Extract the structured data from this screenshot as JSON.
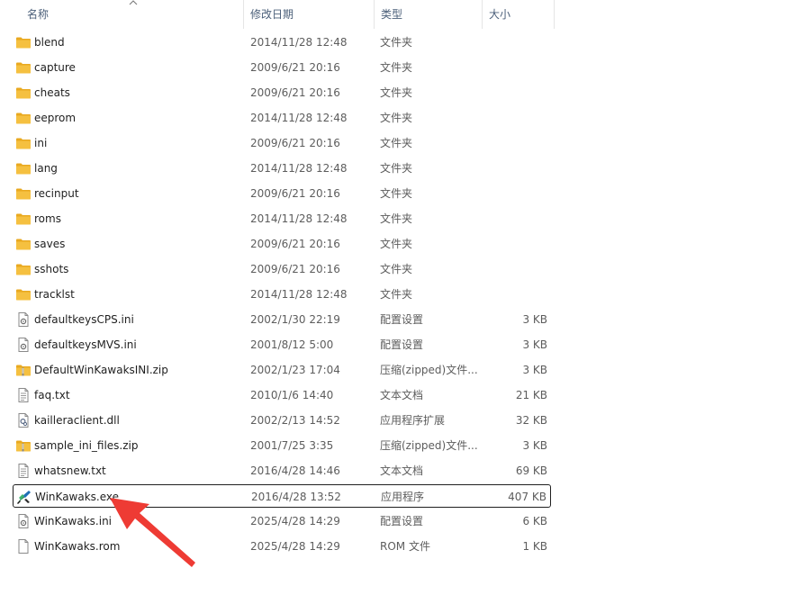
{
  "columns": {
    "name": "名称",
    "date": "修改日期",
    "type": "类型",
    "size": "大小"
  },
  "colors": {
    "folder": "#f5c040",
    "arrow": "#ee3b34",
    "header_text": "#4c607a"
  },
  "files": [
    {
      "name": "blend",
      "date": "2014/11/28 12:48",
      "type": "文件夹",
      "size": "",
      "icon": "folder-icon"
    },
    {
      "name": "capture",
      "date": "2009/6/21 20:16",
      "type": "文件夹",
      "size": "",
      "icon": "folder-icon"
    },
    {
      "name": "cheats",
      "date": "2009/6/21 20:16",
      "type": "文件夹",
      "size": "",
      "icon": "folder-icon"
    },
    {
      "name": "eeprom",
      "date": "2014/11/28 12:48",
      "type": "文件夹",
      "size": "",
      "icon": "folder-icon"
    },
    {
      "name": "ini",
      "date": "2009/6/21 20:16",
      "type": "文件夹",
      "size": "",
      "icon": "folder-icon"
    },
    {
      "name": "lang",
      "date": "2014/11/28 12:48",
      "type": "文件夹",
      "size": "",
      "icon": "folder-icon"
    },
    {
      "name": "recinput",
      "date": "2009/6/21 20:16",
      "type": "文件夹",
      "size": "",
      "icon": "folder-icon"
    },
    {
      "name": "roms",
      "date": "2014/11/28 12:48",
      "type": "文件夹",
      "size": "",
      "icon": "folder-icon"
    },
    {
      "name": "saves",
      "date": "2009/6/21 20:16",
      "type": "文件夹",
      "size": "",
      "icon": "folder-icon"
    },
    {
      "name": "sshots",
      "date": "2009/6/21 20:16",
      "type": "文件夹",
      "size": "",
      "icon": "folder-icon"
    },
    {
      "name": "tracklst",
      "date": "2014/11/28 12:48",
      "type": "文件夹",
      "size": "",
      "icon": "folder-icon"
    },
    {
      "name": "defaultkeysCPS.ini",
      "date": "2002/1/30 22:19",
      "type": "配置设置",
      "size": "3 KB",
      "icon": "config-file-icon"
    },
    {
      "name": "defaultkeysMVS.ini",
      "date": "2001/8/12 5:00",
      "type": "配置设置",
      "size": "3 KB",
      "icon": "config-file-icon"
    },
    {
      "name": "DefaultWinKawaksINI.zip",
      "date": "2002/1/23 17:04",
      "type": "压缩(zipped)文件...",
      "size": "3 KB",
      "icon": "zip-folder-icon"
    },
    {
      "name": "faq.txt",
      "date": "2010/1/6 14:40",
      "type": "文本文档",
      "size": "21 KB",
      "icon": "text-file-icon"
    },
    {
      "name": "kailleraclient.dll",
      "date": "2002/2/13 14:52",
      "type": "应用程序扩展",
      "size": "32 KB",
      "icon": "dll-file-icon"
    },
    {
      "name": "sample_ini_files.zip",
      "date": "2001/7/25 3:35",
      "type": "压缩(zipped)文件...",
      "size": "3 KB",
      "icon": "zip-folder-icon"
    },
    {
      "name": "whatsnew.txt",
      "date": "2016/4/28 14:46",
      "type": "文本文档",
      "size": "69 KB",
      "icon": "text-file-icon"
    },
    {
      "name": "WinKawaks.exe",
      "date": "2016/4/28 13:52",
      "type": "应用程序",
      "size": "407 KB",
      "icon": "app-exe-icon",
      "selected": true
    },
    {
      "name": "WinKawaks.ini",
      "date": "2025/4/28 14:29",
      "type": "配置设置",
      "size": "6 KB",
      "icon": "config-file-icon"
    },
    {
      "name": "WinKawaks.rom",
      "date": "2025/4/28 14:29",
      "type": "ROM 文件",
      "size": "1 KB",
      "icon": "blank-file-icon"
    }
  ]
}
